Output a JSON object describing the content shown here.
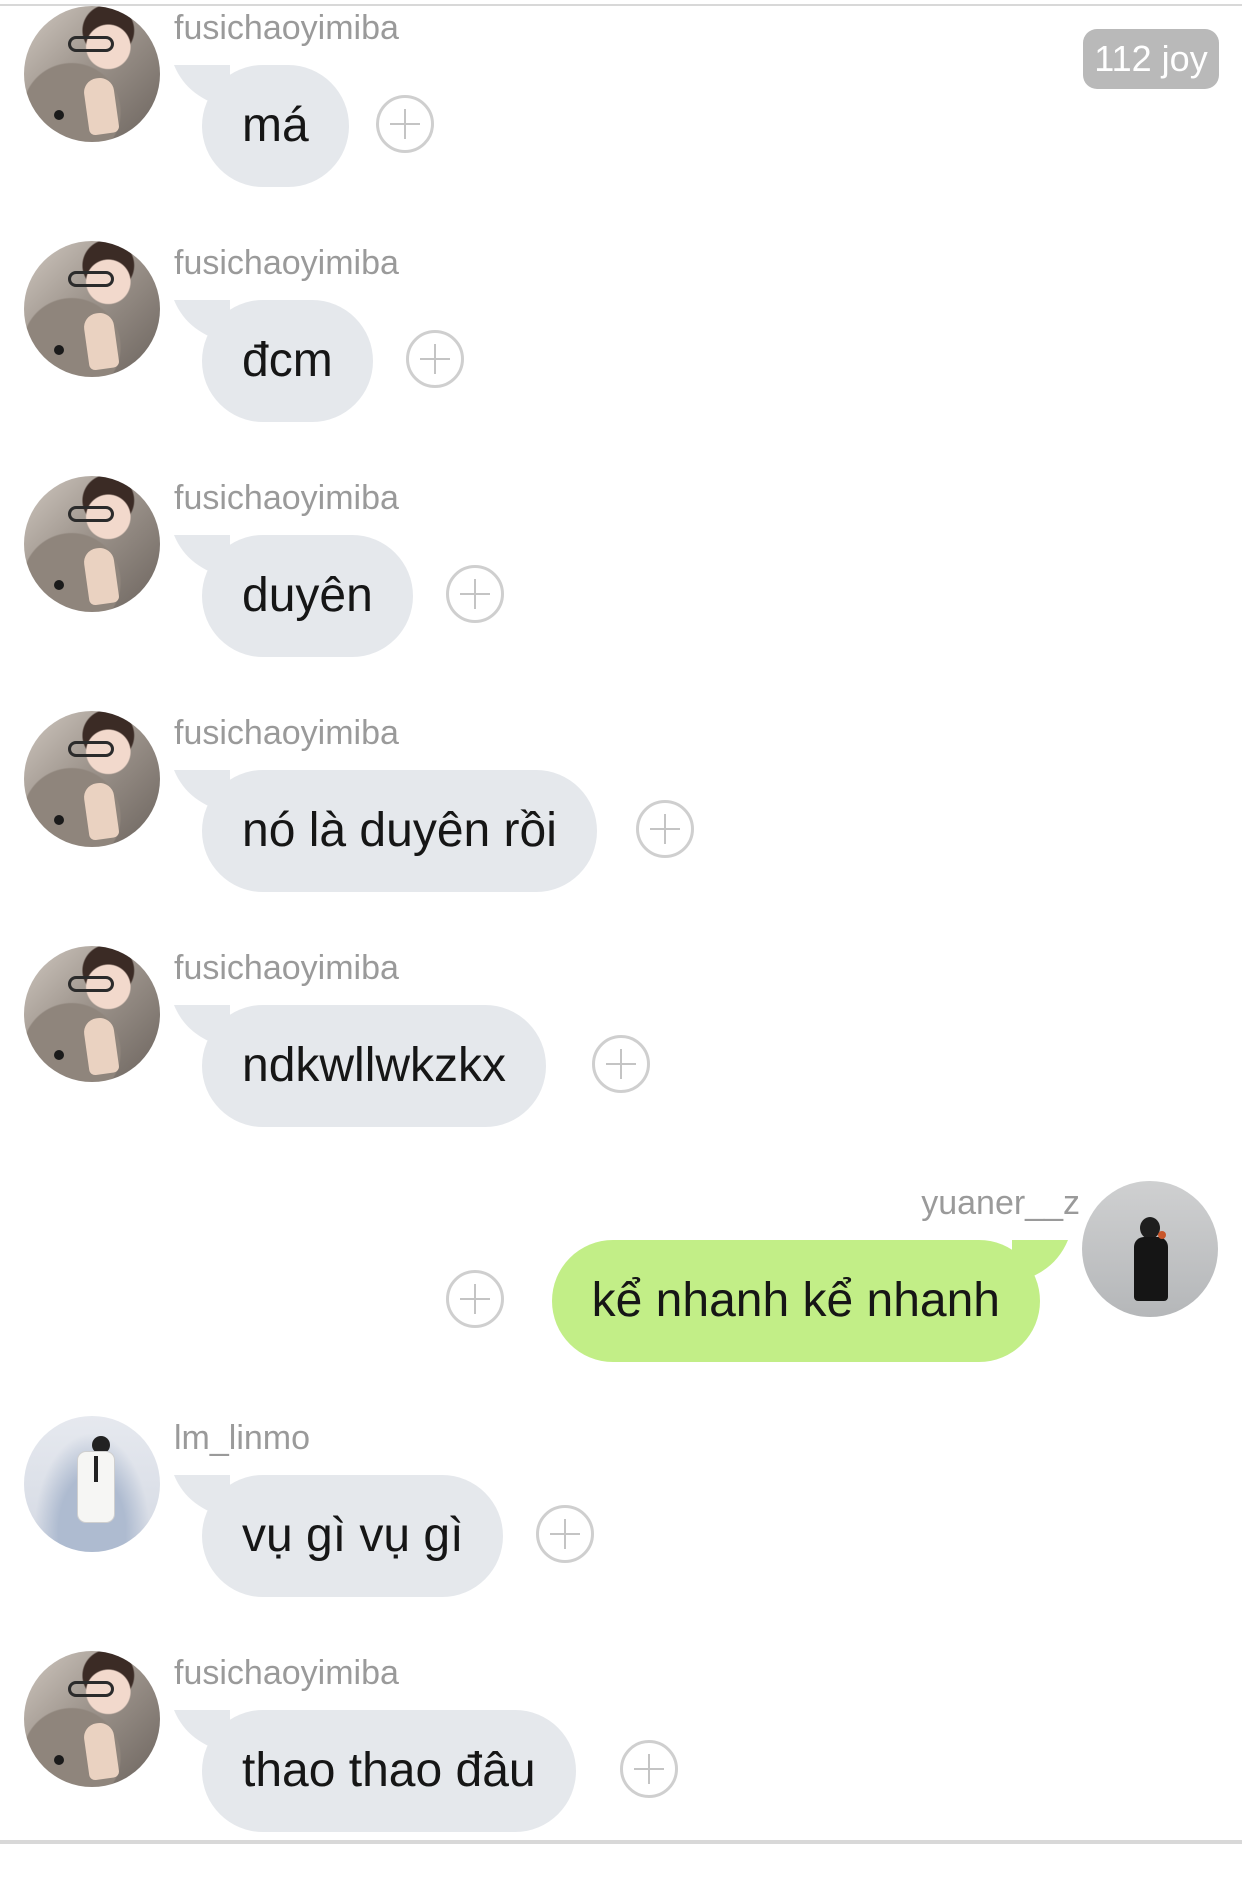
{
  "chat": {
    "badge": "112 joy",
    "messages": [
      {
        "sender": "fusichaoyimiba",
        "text": "má",
        "side": "left",
        "avatar": "fusi-avatar"
      },
      {
        "sender": "fusichaoyimiba",
        "text": "đcm",
        "side": "left",
        "avatar": "fusi-avatar"
      },
      {
        "sender": "fusichaoyimiba",
        "text": "duyên",
        "side": "left",
        "avatar": "fusi-avatar"
      },
      {
        "sender": "fusichaoyimiba",
        "text": "nó là duyên rồi",
        "side": "left",
        "avatar": "fusi-avatar"
      },
      {
        "sender": "fusichaoyimiba",
        "text": "ndkwllwkzkx",
        "side": "left",
        "avatar": "fusi-avatar"
      },
      {
        "sender": "yuaner__z",
        "text": "kể nhanh kể nhanh",
        "side": "right",
        "avatar": "yuaner-avatar"
      },
      {
        "sender": "lm_linmo",
        "text": "vụ gì vụ gì",
        "side": "left",
        "avatar": "linmo-avatar"
      },
      {
        "sender": "fusichaoyimiba",
        "text": "thao thao đâu",
        "side": "left",
        "avatar": "fusi-avatar"
      }
    ]
  },
  "colors": {
    "incoming_bubble": "#e5e8ec",
    "outgoing_bubble": "#c2ee87",
    "username": "#9a9a9a",
    "badge": "#b9b9b9"
  },
  "icons": {
    "react": "plus-circle-icon"
  }
}
